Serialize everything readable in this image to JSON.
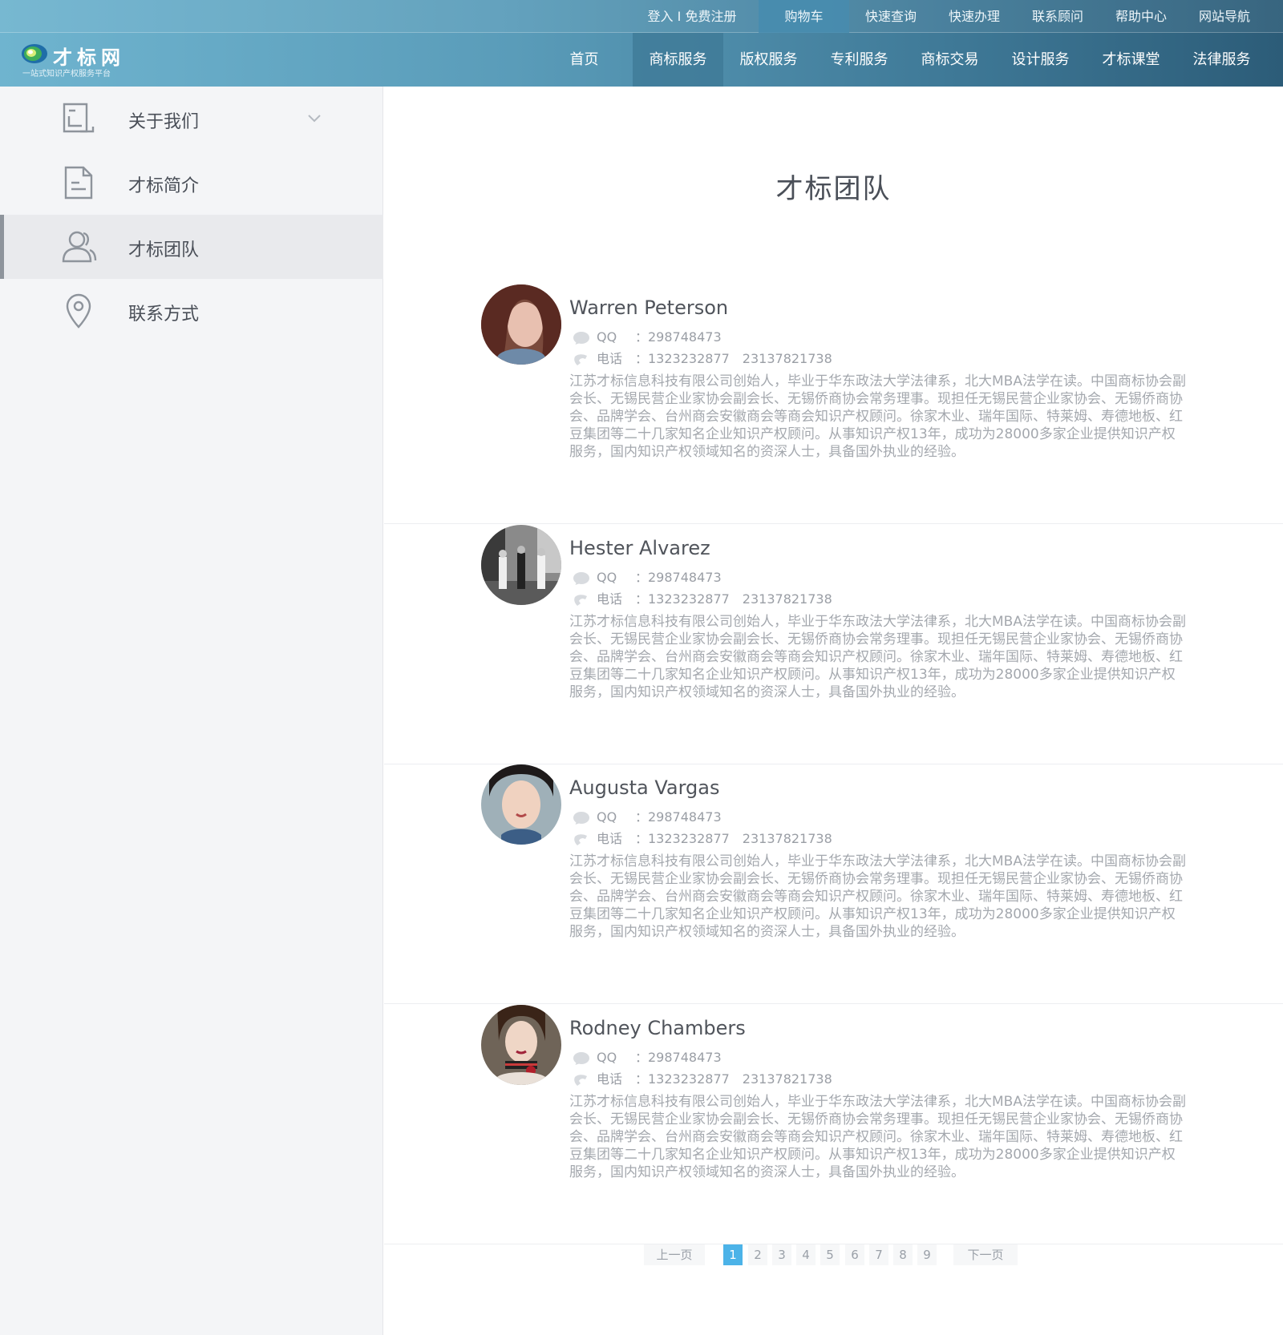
{
  "topbar": {
    "login": "登入 I 免费注册",
    "cart": "购物车",
    "quick_query": "快速查询",
    "quick_handle": "快速办理",
    "contact_advisor": "联系顾问",
    "help": "帮助中心",
    "site_nav": "网站导航"
  },
  "logo": {
    "title": "才标网",
    "subtitle": "一站式知识产权服务平台"
  },
  "nav": [
    "首页",
    "商标服务",
    "版权服务",
    "专利服务",
    "商标交易",
    "设计服务",
    "才标课堂",
    "法律服务"
  ],
  "sidebar": {
    "items": [
      {
        "label": "关于我们",
        "icon": "document-icon"
      },
      {
        "label": "才标简介",
        "icon": "file-icon"
      },
      {
        "label": "才标团队",
        "icon": "users-icon"
      },
      {
        "label": "联系方式",
        "icon": "location-pin-icon"
      }
    ],
    "active_index": 2
  },
  "main": {
    "title": "才标团队",
    "members": [
      {
        "name": "Warren Peterson",
        "qq_label": "QQ",
        "qq": "：298748473",
        "tel_label": "电话",
        "tel": "：1323232877　23137821738",
        "desc": "江苏才标信息科技有限公司创始人，毕业于华东政法大学法律系，北大MBA法学在读。中国商标协会副会长、无锡民营企业家协会副会长、无锡侨商协会常务理事。现担任无锡民营企业家协会、无锡侨商协会、品牌学会、台州商会安徽商会等商会知识产权顾问。徐家木业、瑞年国际、特莱姆、寿德地板、红豆集团等二十几家知名企业知识产权顾问。从事知识产权13年，成功为28000多家企业提供知识产权服务，国内知识产权领域知名的资深人士，具备国外执业的经验。"
      },
      {
        "name": "Hester Alvarez",
        "qq_label": "QQ",
        "qq": "：298748473",
        "tel_label": "电话",
        "tel": "：1323232877　23137821738",
        "desc": "江苏才标信息科技有限公司创始人，毕业于华东政法大学法律系，北大MBA法学在读。中国商标协会副会长、无锡民营企业家协会副会长、无锡侨商协会常务理事。现担任无锡民营企业家协会、无锡侨商协会、品牌学会、台州商会安徽商会等商会知识产权顾问。徐家木业、瑞年国际、特莱姆、寿德地板、红豆集团等二十几家知名企业知识产权顾问。从事知识产权13年，成功为28000多家企业提供知识产权服务，国内知识产权领域知名的资深人士，具备国外执业的经验。"
      },
      {
        "name": "Augusta Vargas",
        "qq_label": "QQ",
        "qq": "：298748473",
        "tel_label": "电话",
        "tel": "：1323232877　23137821738",
        "desc": "江苏才标信息科技有限公司创始人，毕业于华东政法大学法律系，北大MBA法学在读。中国商标协会副会长、无锡民营企业家协会副会长、无锡侨商协会常务理事。现担任无锡民营企业家协会、无锡侨商协会、品牌学会、台州商会安徽商会等商会知识产权顾问。徐家木业、瑞年国际、特莱姆、寿德地板、红豆集团等二十几家知名企业知识产权顾问。从事知识产权13年，成功为28000多家企业提供知识产权服务，国内知识产权领域知名的资深人士，具备国外执业的经验。"
      },
      {
        "name": "Rodney Chambers",
        "qq_label": "QQ",
        "qq": "：298748473",
        "tel_label": "电话",
        "tel": "：1323232877　23137821738",
        "desc": "江苏才标信息科技有限公司创始人，毕业于华东政法大学法律系，北大MBA法学在读。中国商标协会副会长、无锡民营企业家协会副会长、无锡侨商协会常务理事。现担任无锡民营企业家协会、无锡侨商协会、品牌学会、台州商会安徽商会等商会知识产权顾问。徐家木业、瑞年国际、特莱姆、寿德地板、红豆集团等二十几家知名企业知识产权顾问。从事知识产权13年，成功为28000多家企业提供知识产权服务，国内知识产权领域知名的资深人士，具备国外执业的经验。"
      }
    ]
  },
  "pager": {
    "prev": "上一页",
    "next": "下一页",
    "pages": [
      "1",
      "2",
      "3",
      "4",
      "5",
      "6",
      "7",
      "8",
      "9"
    ],
    "current": 1
  },
  "colors": {
    "header_start": "#6fb4cf",
    "header_end": "#2c5c78",
    "active_page": "#4cb3e8",
    "sidebar_bg": "#f4f5f7"
  }
}
